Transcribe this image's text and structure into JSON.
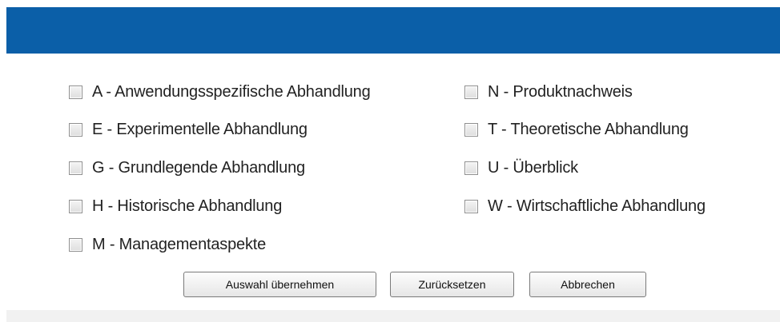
{
  "filter": {
    "options_left": [
      {
        "label": "A - Anwendungsspezifische Abhandlung",
        "checked": false
      },
      {
        "label": "E - Experimentelle Abhandlung",
        "checked": false
      },
      {
        "label": "G - Grundlegende Abhandlung",
        "checked": false
      },
      {
        "label": "H - Historische Abhandlung",
        "checked": false
      },
      {
        "label": "M - Managementaspekte",
        "checked": false
      }
    ],
    "options_right": [
      {
        "label": "N - Produktnachweis",
        "checked": false
      },
      {
        "label": "T - Theoretische Abhandlung",
        "checked": false
      },
      {
        "label": "U - Überblick",
        "checked": false
      },
      {
        "label": "W - Wirtschaftliche Abhandlung",
        "checked": false
      }
    ]
  },
  "actions": {
    "apply_label": "Auswahl übernehmen",
    "reset_label": "Zurücksetzen",
    "cancel_label": "Abbrechen"
  },
  "colors": {
    "header": "#0b5fa8",
    "footer": "#f1f1f1"
  }
}
